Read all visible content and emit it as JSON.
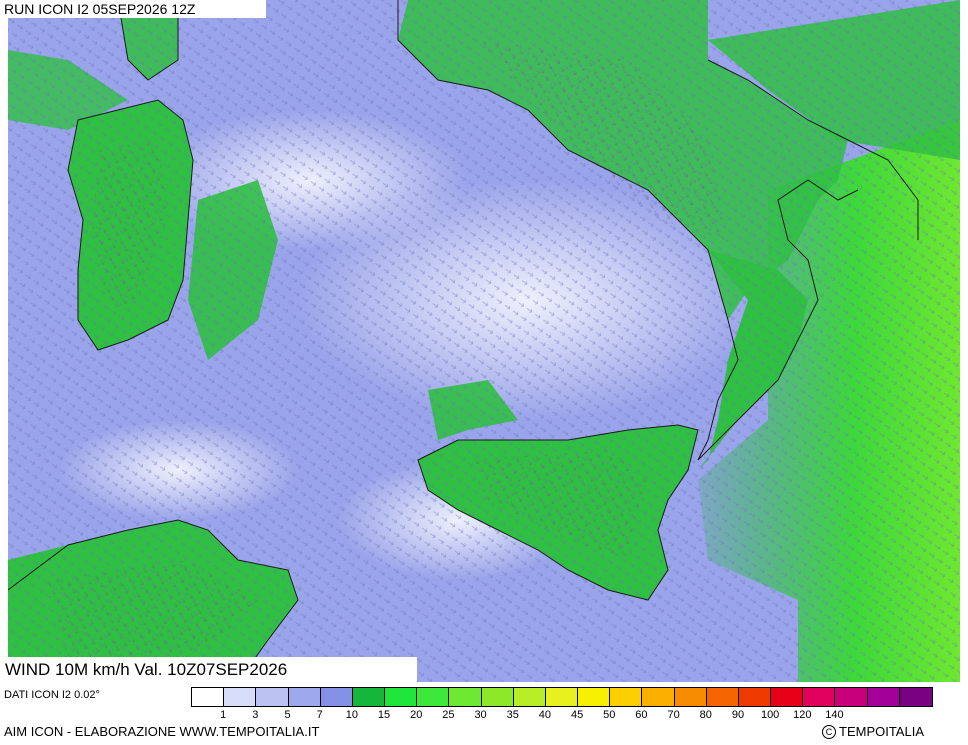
{
  "header": {
    "run_title": "RUN ICON I2 05SEP2026 12Z"
  },
  "footer": {
    "variable_title": "WIND 10M km/h Val. 10Z07SEP2026",
    "data_source": "DATI ICON I2 0.02°",
    "credit_left": "AIM ICON - ELABORAZIONE WWW.TEMPOITALIA.IT",
    "credit_right": "TEMPOITALIA",
    "copyright_symbol": "C"
  },
  "legend": {
    "unit": "km/h",
    "colors": [
      "#ffffff",
      "#d7dcf8",
      "#bac3f2",
      "#9ea8ec",
      "#8490e6",
      "#16b63a",
      "#1de53c",
      "#3ee83a",
      "#6ee830",
      "#8ee82a",
      "#b8ee26",
      "#e8f020",
      "#f7f000",
      "#fcd000",
      "#fbb000",
      "#f88c00",
      "#f46400",
      "#ee3a00",
      "#e80018",
      "#e2005e",
      "#c8007a",
      "#a20098",
      "#7a0082"
    ],
    "labels": [
      "1",
      "3",
      "5",
      "7",
      "10",
      "15",
      "20",
      "25",
      "30",
      "35",
      "40",
      "45",
      "50",
      "60",
      "70",
      "80",
      "90",
      "100",
      "120",
      "140"
    ]
  },
  "map": {
    "regions": [
      "Sardegna",
      "Sicilia",
      "Calabria",
      "Tunisia"
    ],
    "sea_color": "#9aa4ea",
    "land_color": "#2fbf42"
  }
}
